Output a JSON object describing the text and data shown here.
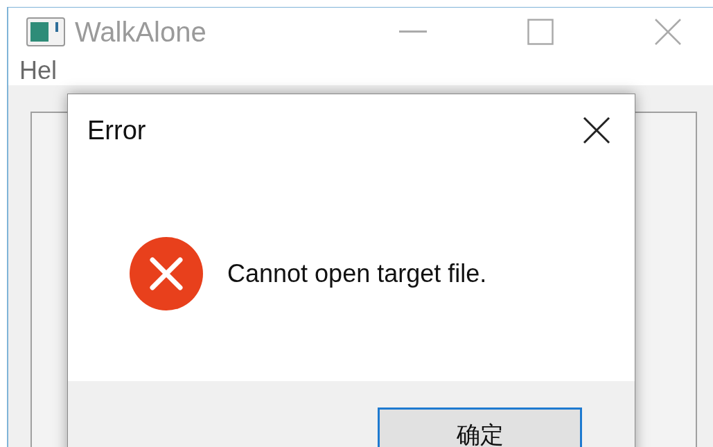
{
  "window": {
    "title": "WalkAlone"
  },
  "menu": [
    {
      "label": "Hel"
    }
  ],
  "dialog": {
    "title": "Error",
    "message": "Cannot open target file.",
    "kind": "error",
    "buttons": [
      {
        "label": "确定",
        "selected": true
      }
    ]
  }
}
